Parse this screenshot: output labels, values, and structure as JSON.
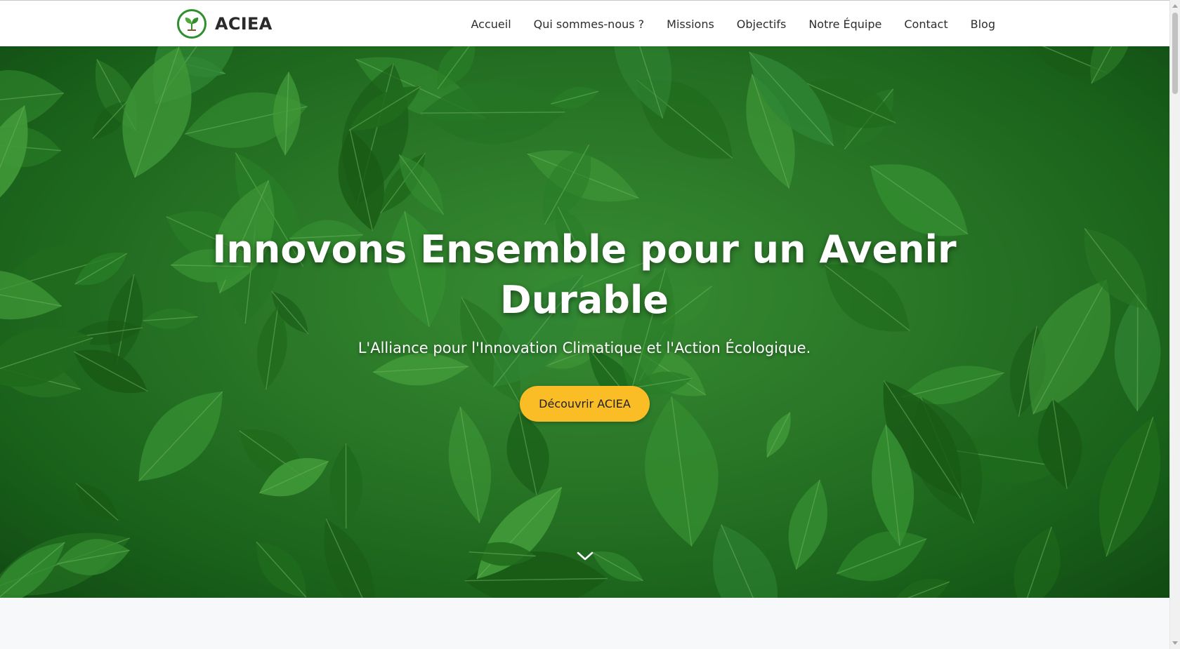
{
  "header": {
    "brand_name": "ACIEA",
    "logo_icon": "leaf-sprout-logo-icon",
    "nav_items": [
      {
        "label": "Accueil"
      },
      {
        "label": "Qui sommes-nous ?"
      },
      {
        "label": "Missions"
      },
      {
        "label": "Objectifs"
      },
      {
        "label": "Notre Équipe"
      },
      {
        "label": "Contact"
      },
      {
        "label": "Blog"
      }
    ]
  },
  "hero": {
    "title": "Innovons Ensemble pour un Avenir Durable",
    "subtitle": "L'Alliance pour l'Innovation Climatique et l'Action Écologique.",
    "cta_label": "Découvrir ACIEA",
    "scroll_icon": "chevron-down-icon"
  },
  "colors": {
    "header_bg": "#ffffff",
    "nav_text": "#2d2d2d",
    "hero_green": "#2c7f2a",
    "cta_bg": "#fbbd26",
    "section_bg": "#f7f8fa",
    "logo_ring": "#2f8f2f"
  }
}
